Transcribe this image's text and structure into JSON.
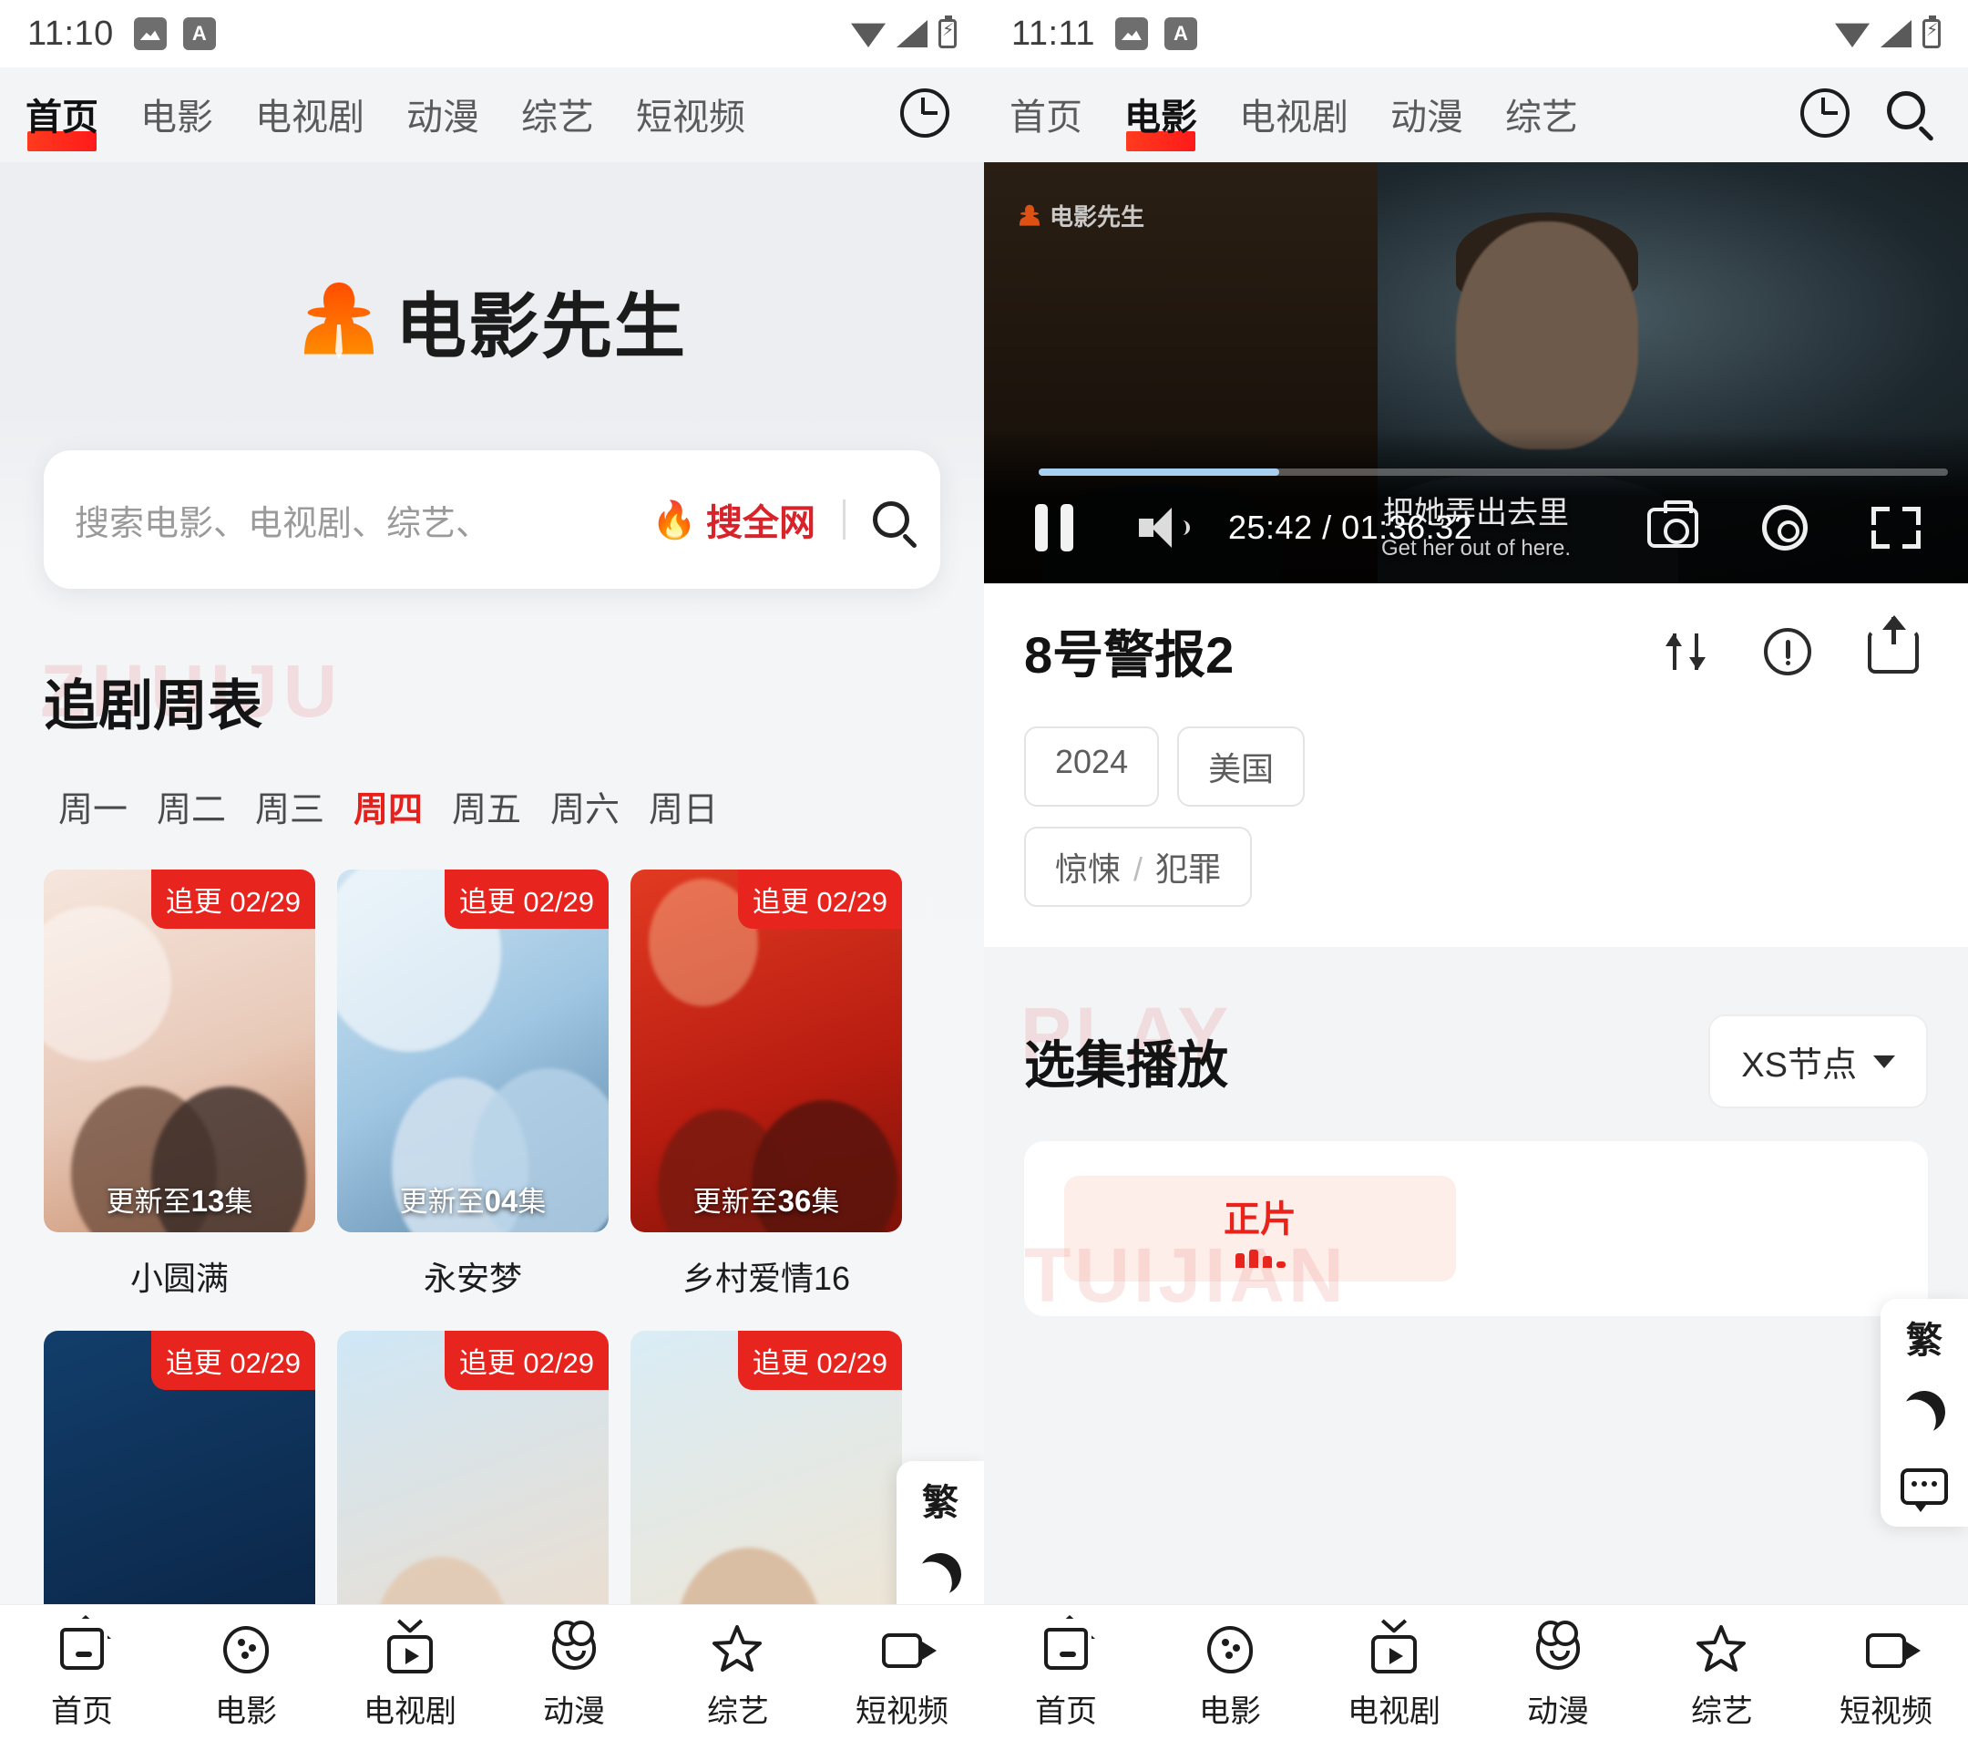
{
  "left": {
    "status": {
      "time": "11:10",
      "icons": [
        "gallery-badge",
        "a-badge"
      ]
    },
    "topnav": {
      "tabs": [
        {
          "label": "首页",
          "active": true
        },
        {
          "label": "电影",
          "active": false
        },
        {
          "label": "电视剧",
          "active": false
        },
        {
          "label": "动漫",
          "active": false
        },
        {
          "label": "综艺",
          "active": false
        },
        {
          "label": "短视频",
          "active": false
        }
      ],
      "actions": [
        "history-clock-icon",
        "search-icon"
      ]
    },
    "brand": {
      "name": "电影先生"
    },
    "search": {
      "placeholder": "搜索电影、电视剧、综艺、",
      "hot_label": "搜全网",
      "flame": "🔥"
    },
    "section": {
      "watermark": "ZHUIJU",
      "title": "追剧周表",
      "weekdays": [
        {
          "label": "周一",
          "active": false
        },
        {
          "label": "周二",
          "active": false
        },
        {
          "label": "周三",
          "active": false
        },
        {
          "label": "周四",
          "active": true
        },
        {
          "label": "周五",
          "active": false
        },
        {
          "label": "周六",
          "active": false
        },
        {
          "label": "周日",
          "active": false
        }
      ],
      "cards_row1": [
        {
          "tag": "追更 02/29",
          "episode_prefix": "更新至",
          "episode_num": "13",
          "episode_suffix": "集",
          "title": "小圆满"
        },
        {
          "tag": "追更 02/29",
          "episode_prefix": "更新至",
          "episode_num": "04",
          "episode_suffix": "集",
          "title": "永安梦"
        },
        {
          "tag": "追更 02/29",
          "episode_prefix": "更新至",
          "episode_num": "36",
          "episode_suffix": "集",
          "title": "乡村爱情16"
        }
      ],
      "cards_row2": [
        {
          "tag": "追更 02/29",
          "title": ""
        },
        {
          "tag": "追更 02/29",
          "title": ""
        },
        {
          "tag": "追更 02/29",
          "title": ""
        }
      ]
    },
    "dock": {
      "lang": "繁",
      "icons": [
        "moon-icon",
        "chat-icon"
      ]
    }
  },
  "right": {
    "status": {
      "time": "11:11"
    },
    "topnav": {
      "tabs": [
        {
          "label": "首页",
          "active": false
        },
        {
          "label": "电影",
          "active": true
        },
        {
          "label": "电视剧",
          "active": false
        },
        {
          "label": "动漫",
          "active": false
        },
        {
          "label": "综艺",
          "active": false
        }
      ],
      "actions": [
        "history-clock-icon",
        "search-icon"
      ]
    },
    "player": {
      "watermark": "电影先生",
      "subtitle_cn": "把她弄出去里",
      "subtitle_en": "Get her out of here.",
      "current_time": "25:42",
      "total_time": "01:36:32",
      "time_display": "25:42 / 01:36:32",
      "progress_percent": 26.5,
      "controls": [
        "pause-button",
        "volume-icon",
        "snapshot-icon",
        "settings-gear-icon",
        "fullscreen-icon"
      ],
      "progress_color": "#a8cff0"
    },
    "detail": {
      "title": "8号警报2",
      "actions": [
        "sort-order-icon",
        "report-icon",
        "share-icon"
      ],
      "tags_row1": [
        "2024",
        "美国"
      ],
      "tags_row2_left": "惊悚",
      "tags_row2_sep": "/",
      "tags_row2_right": "犯罪"
    },
    "play_section": {
      "watermark": "PLAY",
      "title": "选集播放",
      "node_label": "XS节点",
      "episodes": [
        {
          "label": "正片",
          "playing": true
        }
      ],
      "recommend_watermark": "TUIJIAN"
    },
    "dock": {
      "lang": "繁",
      "icons": [
        "moon-icon",
        "chat-icon"
      ]
    }
  },
  "bottomnav": {
    "items": [
      {
        "label": "首页",
        "icon": "home-icon"
      },
      {
        "label": "电影",
        "icon": "film-reel-icon"
      },
      {
        "label": "电视剧",
        "icon": "tv-play-icon"
      },
      {
        "label": "动漫",
        "icon": "bear-face-icon"
      },
      {
        "label": "综艺",
        "icon": "star-icon"
      },
      {
        "label": "短视频",
        "icon": "video-camera-icon"
      }
    ]
  },
  "colors": {
    "accent_red": "#e8231c",
    "brand_orange": "#ff6a00",
    "progress_blue": "#a8cff0",
    "page_bg": "#f3f4f6"
  }
}
